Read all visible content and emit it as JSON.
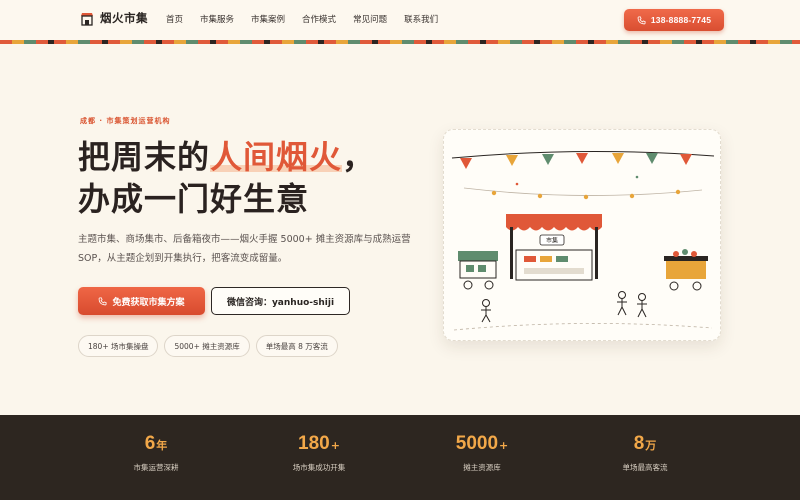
{
  "header": {
    "brand": "烟火市集",
    "nav": [
      "首页",
      "市集服务",
      "市集案例",
      "合作模式",
      "常见问题",
      "联系我们"
    ],
    "phone": "138-8888-7745",
    "phone_icon": "phone-icon"
  },
  "hero": {
    "eyebrow": "成都 · 市集策划运营机构",
    "title_part1": "把周末的",
    "title_highlight": "人间烟火",
    "title_part2": "，",
    "title_line2": "办成一门好生意",
    "description": "主题市集、商场集市、后备箱夜市——烟火手握 5000+ 摊主资源库与成熟运营 SOP，从主题企划到开集执行，把客流变成留量。",
    "cta_label": "免费获取市集方案",
    "wechat_label": "微信咨询：yanhuo-shiji",
    "tags": [
      "180+ 场市集操盘",
      "5000+ 摊主资源库",
      "单场最高 8 万客流"
    ]
  },
  "illustration": {
    "booth_sign": "市集"
  },
  "stats": [
    {
      "value": "6",
      "unit": "年",
      "label": "市集运营深耕"
    },
    {
      "value": "180",
      "unit": "+",
      "label": "场市集成功开集"
    },
    {
      "value": "5000",
      "unit": "+",
      "label": "摊主资源库"
    },
    {
      "value": "8",
      "unit": "万",
      "label": "单场最高客流"
    }
  ],
  "colors": {
    "accent": "#e05838",
    "stat_highlight": "#f2a849",
    "dark_band": "#2d2620",
    "background": "#fbf6ec"
  }
}
